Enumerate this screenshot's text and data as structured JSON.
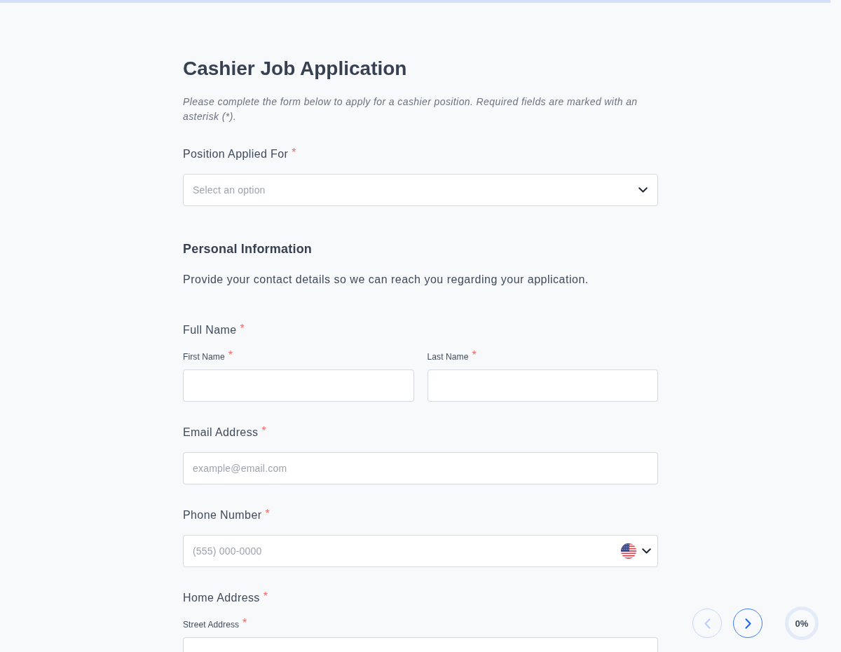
{
  "form": {
    "title": "Cashier Job Application",
    "description": "Please complete the form below to apply for a cashier position. Required fields are marked with an asterisk (*).",
    "required_marker": "*"
  },
  "questions": [
    {
      "kind": "select",
      "label": "Position Applied For",
      "required": true,
      "placeholder": "Select an option"
    },
    {
      "kind": "section",
      "title": "Personal Information",
      "description": "Provide your contact details so we can reach you regarding your application."
    },
    {
      "kind": "name",
      "label": "Full Name",
      "required": true,
      "subfields": [
        {
          "label": "First Name",
          "required": true
        },
        {
          "label": "Last Name",
          "required": true
        }
      ]
    },
    {
      "kind": "text",
      "label": "Email Address",
      "required": true,
      "placeholder": "example@email.com"
    },
    {
      "kind": "phone",
      "label": "Phone Number",
      "required": true,
      "placeholder": "(555) 000-0000"
    },
    {
      "kind": "address",
      "label": "Home Address",
      "required": true,
      "subfields": [
        {
          "label": "Street Address",
          "required": true
        }
      ]
    }
  ],
  "navigation": [
    {
      "kind": "previous",
      "disabled": true
    },
    {
      "kind": "next",
      "disabled": false
    }
  ],
  "progress": {
    "level": 0,
    "reading": "0%"
  }
}
